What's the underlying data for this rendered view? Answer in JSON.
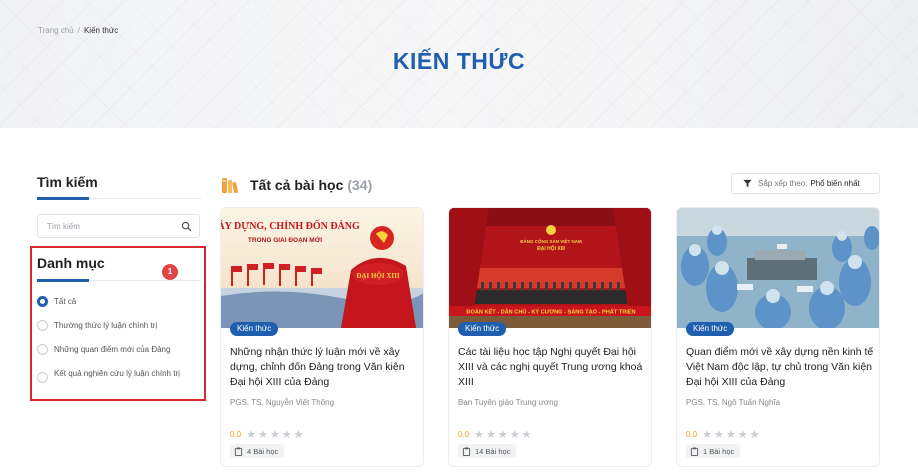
{
  "breadcrumb": {
    "home": "Trang chủ",
    "separator": "/",
    "current": "Kiến thức"
  },
  "hero": {
    "title": "KIẾN THỨC"
  },
  "sidebar": {
    "search_title": "Tìm kiếm",
    "search_placeholder": "Tìm kiếm",
    "category_title": "Danh mục",
    "badge": "1",
    "categories": [
      {
        "label": "Tất cả",
        "selected": true
      },
      {
        "label": "Thường thức lý luận chính trị",
        "selected": false
      },
      {
        "label": "Những quan điểm mới của Đảng",
        "selected": false
      },
      {
        "label": "Kết quả nghiên cứu lý luận chính trị",
        "selected": false
      }
    ]
  },
  "main": {
    "title": "Tất cả bài học",
    "count": "(34)",
    "sort_prefix": "Sắp xếp theo:",
    "sort_value": "Phổ biến nhất"
  },
  "cards": [
    {
      "image_text": "XÂY DỰNG, CHỈNH ĐỐN ĐẢNG",
      "image_sub": "TRONG GIAI ĐOẠN MỚI",
      "image_badge": "ĐẠI HỘI XIII",
      "tag": "Kiến thức",
      "title": "Những nhận thức lý luận mới về xây dựng, chỉnh đốn Đảng trong Văn kiện Đại hội XIII của Đảng",
      "author": "PGS. TS. Nguyễn Viết Thông",
      "rating": "0.0",
      "stars": "★★★★★",
      "lessons": "4 Bài học"
    },
    {
      "image_text": "ĐẢNG CỘNG SẢN VIỆT NAM",
      "image_sub": "ĐẠI HỘI XIII",
      "image_banner": "ĐOÀN KẾT - DÂN CHỦ - KỶ CƯƠNG - SÁNG TẠO - PHÁT TRIỂN",
      "tag": "Kiến thức",
      "title": "Các tài liệu học tập Nghị quyết Đại hội XIII và các nghị quyết Trung ương khoá XIII",
      "author": "Ban Tuyên giáo Trung ương",
      "rating": "0.0",
      "stars": "★★★★★",
      "lessons": "14 Bài học"
    },
    {
      "tag": "Kiến thức",
      "title": "Quan điểm mới về xây dựng nền kinh tế Việt Nam độc lập, tự chủ trong Văn kiện Đại hội XIII của Đảng",
      "author": "PGS. TS. Ngô Tuấn Nghĩa",
      "rating": "0.0",
      "stars": "★★★★★",
      "lessons": "1 Bài học"
    }
  ],
  "colors": {
    "accent": "#1f5fae",
    "highlight_box": "#d8272d",
    "badge": "#e24545",
    "rating": "#e8a317"
  }
}
